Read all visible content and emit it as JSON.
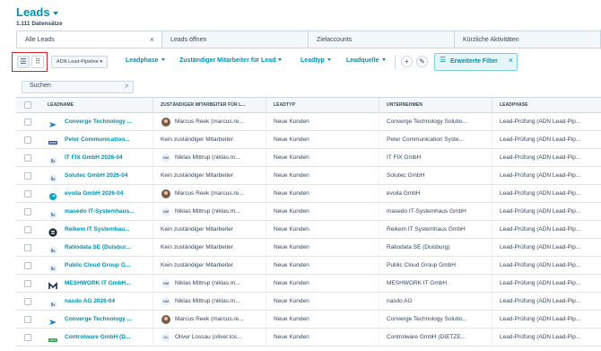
{
  "header": {
    "title": "Leads",
    "record_count": "1.111 Datensätze"
  },
  "tabs": [
    {
      "label": "Alle Leads",
      "active": true,
      "closable": true
    },
    {
      "label": "Leads öffnen",
      "active": false,
      "closable": false
    },
    {
      "label": "Zielaccounts",
      "active": false,
      "closable": false
    },
    {
      "label": "Kürzliche Aktivitäten",
      "active": false,
      "closable": false
    }
  ],
  "toolbar": {
    "view_list_icon": "list-icon",
    "view_board_icon": "grid-icon",
    "pipeline_select": "ADN Lead-Pipeline",
    "filters": [
      "Leadphase",
      "Zuständiger Mitarbeiter für Lead",
      "Leadtyp",
      "Leadquelle"
    ],
    "add_icon": "+",
    "edit_icon": "✎",
    "advanced_filter_label": "Erweiterte Filter",
    "advanced_filter_icon": "☰",
    "close_icon": "×"
  },
  "search": {
    "placeholder": "Suchen"
  },
  "table": {
    "columns": [
      "LEADNAME",
      "ZUSTÄNDIGER MITARBEITER FÜR L...",
      "LEADTYP",
      "UNTERNEHMEN",
      "LEADPHASE"
    ],
    "rows": [
      {
        "leadname": "Converge Technology ...",
        "logo": "converge-logo",
        "owner": "Marcus Reek (marcus.re...",
        "owner_avatar": "photo",
        "owner_initials": "",
        "leadtyp": "Neue Kunden",
        "unternehmen": "Converge Technology Solutio...",
        "leadphase": "Lead-Prüfung (ADN Lead-Pip..."
      },
      {
        "leadname": "Peter Communication...",
        "logo": "peter-logo",
        "owner": "Kein zuständiger Mitarbeiter",
        "owner_avatar": "none",
        "owner_initials": "",
        "leadtyp": "Neue Kunden",
        "unternehmen": "Peter Communication Syste...",
        "leadphase": "Lead-Prüfung (ADN Lead-Pip..."
      },
      {
        "leadname": "IT FIX GmbH 2026-04",
        "logo": "company-placeholder-logo",
        "owner": "Niklas Mittrup (niklas.m...",
        "owner_avatar": "initials",
        "owner_initials": "NM",
        "leadtyp": "Neue Kunden",
        "unternehmen": "IT FIX GmbH",
        "leadphase": "Lead-Prüfung (ADN Lead-Pip..."
      },
      {
        "leadname": "Solutec GmbH 2026-04",
        "logo": "company-placeholder-logo",
        "owner": "Kein zuständiger Mitarbeiter",
        "owner_avatar": "none",
        "owner_initials": "",
        "leadtyp": "Neue Kunden",
        "unternehmen": "Solutec GmbH",
        "leadphase": "Lead-Prüfung (ADN Lead-Pip..."
      },
      {
        "leadname": "evoila GmbH 2026-04",
        "logo": "evoila-logo",
        "owner": "Marcus Reek (marcus.re...",
        "owner_avatar": "photo",
        "owner_initials": "",
        "leadtyp": "Neue Kunden",
        "unternehmen": "evoila GmbH",
        "leadphase": "Lead-Prüfung (ADN Lead-Pip..."
      },
      {
        "leadname": "masedo IT-Systemhaus...",
        "logo": "company-placeholder-logo",
        "owner": "Niklas Mittrup (niklas.m...",
        "owner_avatar": "initials",
        "owner_initials": "NM",
        "leadtyp": "Neue Kunden",
        "unternehmen": "masedo IT-Systemhaus GmbH",
        "leadphase": "Lead-Prüfung (ADN Lead-Pip..."
      },
      {
        "leadname": "Reikem IT Systemhau...",
        "logo": "reikem-logo",
        "owner": "Kein zuständiger Mitarbeiter",
        "owner_avatar": "none",
        "owner_initials": "",
        "leadtyp": "Neue Kunden",
        "unternehmen": "Reikem IT Systemhaus GmbH",
        "leadphase": "Lead-Prüfung (ADN Lead-Pip..."
      },
      {
        "leadname": "Ratiodata SE (Duisbur...",
        "logo": "company-placeholder-logo",
        "owner": "Kein zuständiger Mitarbeiter",
        "owner_avatar": "none",
        "owner_initials": "",
        "leadtyp": "Neue Kunden",
        "unternehmen": "Ratiodata SE (Duisburg)",
        "leadphase": "Lead-Prüfung (ADN Lead-Pip..."
      },
      {
        "leadname": "Public Cloud Group G...",
        "logo": "company-placeholder-logo",
        "owner": "Kein zuständiger Mitarbeiter",
        "owner_avatar": "none",
        "owner_initials": "",
        "leadtyp": "Neue Kunden",
        "unternehmen": "Public Cloud Group GmbH",
        "leadphase": "Lead-Prüfung (ADN Lead-Pip..."
      },
      {
        "leadname": "MESHWORK IT GmbH...",
        "logo": "meshwork-logo",
        "owner": "Niklas Mittrup (niklas.m...",
        "owner_avatar": "initials",
        "owner_initials": "NM",
        "leadtyp": "Neue Kunden",
        "unternehmen": "MESHWORK IT GmbH",
        "leadphase": "Lead-Prüfung (ADN Lead-Pip..."
      },
      {
        "leadname": "nasdo AG 2026-04",
        "logo": "company-placeholder-logo",
        "owner": "Niklas Mittrup (niklas.m...",
        "owner_avatar": "initials",
        "owner_initials": "NM",
        "leadtyp": "Neue Kunden",
        "unternehmen": "nasdo AG",
        "leadphase": "Lead-Prüfung (ADN Lead-Pip..."
      },
      {
        "leadname": "Converge Technology ...",
        "logo": "converge-logo",
        "owner": "Marcus Reek (marcus.re...",
        "owner_avatar": "photo",
        "owner_initials": "",
        "leadtyp": "Neue Kunden",
        "unternehmen": "Converge Technology Solutio...",
        "leadphase": "Lead-Prüfung (ADN Lead-Pip..."
      },
      {
        "leadname": "Controlware GmbH (D...",
        "logo": "controlware-logo",
        "owner": "Oliver Lossau (oliver.los...",
        "owner_avatar": "initials",
        "owner_initials": "OL",
        "leadtyp": "Neue Kunden",
        "unternehmen": "Controlware GmbH (DIETZE...",
        "leadphase": "Lead-Prüfung (ADN Lead-Pip..."
      }
    ]
  }
}
